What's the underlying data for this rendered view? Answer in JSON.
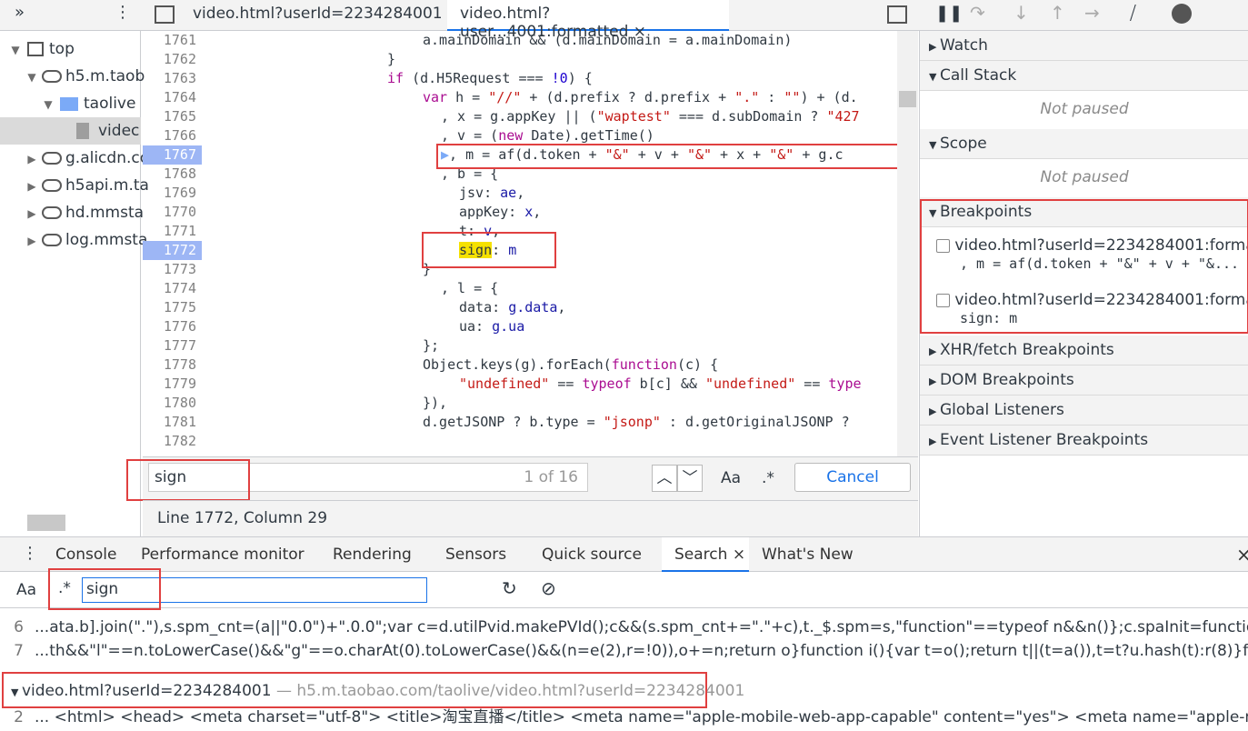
{
  "toolbar": {
    "tab1": "video.html?userId=2234284001",
    "tab2": "video.html?user...4001:formatted",
    "tab2_close": "×"
  },
  "nav": {
    "top": "top",
    "domain1": "h5.m.taob",
    "folder": "taolive",
    "file": "videc",
    "d2": "g.alicdn.co",
    "d3": "h5api.m.ta",
    "d4": "hd.mmsta",
    "d5": "log.mmsta"
  },
  "code": {
    "lines": [
      "1761",
      "1762",
      "1763",
      "1764",
      "1765",
      "1766",
      "1767",
      "1768",
      "1769",
      "1770",
      "1771",
      "1772",
      "1773",
      "1774",
      "1775",
      "1776",
      "1777",
      "1778",
      "1779",
      "1780",
      "1781",
      "1782"
    ]
  },
  "find": {
    "value": "sign",
    "count": "1 of 16",
    "aa": "Aa",
    "regex": ".*",
    "cancel": "Cancel"
  },
  "status": "Line 1772, Column 29",
  "right": {
    "watch": "Watch",
    "callstack": "Call Stack",
    "notpaused1": "Not paused",
    "scope": "Scope",
    "notpaused2": "Not paused",
    "breakpoints": "Breakpoints",
    "bp1_file": "video.html?userId=2234284001:format...",
    "bp1_code": ", m = af(d.token + \"&\" + v + \"&...",
    "bp2_file": "video.html?userId=2234284001:format...",
    "bp2_code": "sign: m",
    "xhr": "XHR/fetch Breakpoints",
    "dom": "DOM Breakpoints",
    "global": "Global Listeners",
    "event": "Event Listener Breakpoints"
  },
  "drawer": {
    "tabs": [
      "Console",
      "Performance monitor",
      "Rendering",
      "Sensors",
      "Quick source",
      "Search",
      "What's New"
    ],
    "close": "×",
    "search_value": "sign",
    "aa": "Aa",
    "regex": ".*",
    "r6num": "6",
    "r6": "...ata.b].join(\".\"),s.spm_cnt=(a||\"0.0\")+\".0.0\";var c=d.utilPvid.makePVId();c&&(s.spm_cnt+=\".\"+c),t._$.spm=s,\"function\"==typeof n&&n()};c.spaInit=function(t,e,n,o){var ...",
    "r7num": "7",
    "r7": "...th&&\"l\"==n.toLowerCase()&&\"g\"==o.charAt(0).toLowerCase()&&(n=e(2),r=!0)),o+=n;return o}function i(){var t=o();return t||(t=a()),t=t?u.hash(t):r(8)}function s(){ret...",
    "file": "video.html?userId=2234284001",
    "fileurl": "— h5.m.taobao.com/taolive/video.html?userId=2234284001",
    "r2num": "2",
    "r2": "... <html> <head> <meta charset=\"utf-8\"> <title>淘宝直播</title> <meta name=\"apple-mobile-web-app-capable\" content=\"yes\"> <meta name=\"apple-mobile-..."
  }
}
